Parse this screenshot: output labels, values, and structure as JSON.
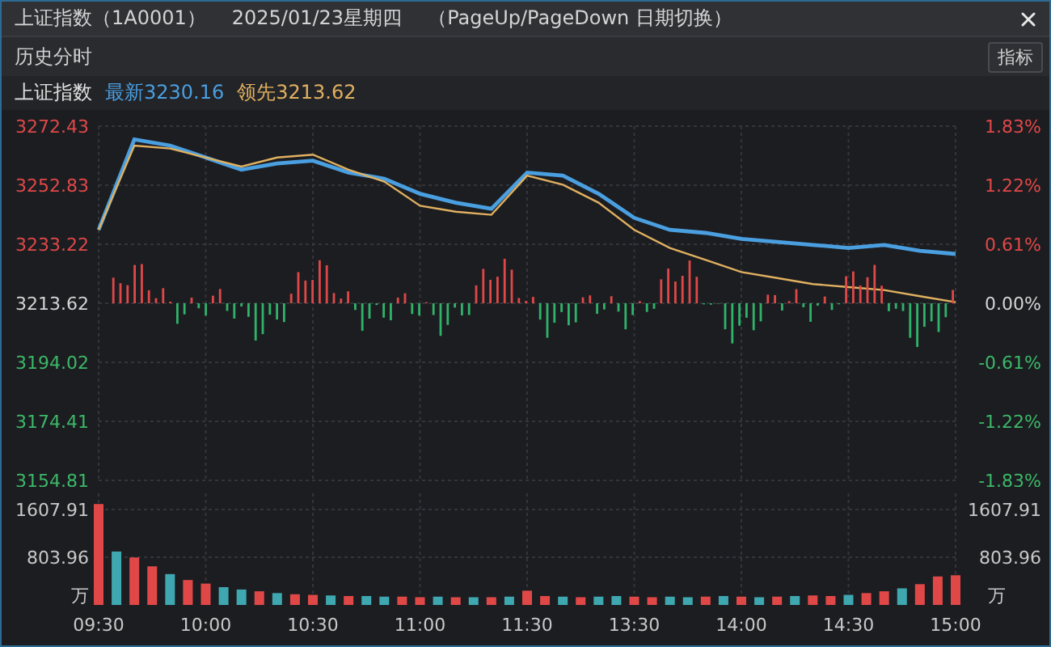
{
  "window": {
    "title_parts": [
      "上证指数（1A0001）",
      "2025/01/23星期四",
      "（PageUp/PageDown 日期切换）"
    ]
  },
  "toolbar": {
    "label": "历史分时",
    "button": "指标"
  },
  "quote": {
    "name": "上证指数",
    "latest": "最新3230.16",
    "leading": "领先3213.62"
  },
  "price_chart": {
    "chart_data": {
      "type": "line",
      "grid": true,
      "categories": [
        null,
        null,
        null,
        null,
        null,
        null,
        null,
        null,
        null,
        null,
        null,
        null,
        null,
        null,
        null,
        null,
        null,
        null,
        null,
        null,
        null,
        null,
        null,
        null,
        null
      ],
      "ylim": [
        3154.81,
        3272.43
      ],
      "yticks": [
        {
          "value": 3272.43,
          "label": "3272.43"
        },
        {
          "value": 3252.83,
          "label": "3252.83"
        },
        {
          "value": 3233.22,
          "label": "3233.22"
        },
        {
          "value": 3213.62,
          "label": "3213.62"
        },
        {
          "value": 3194.02,
          "label": "3194.02"
        },
        {
          "value": 3174.41,
          "label": "3174.41"
        },
        {
          "value": 3154.81,
          "label": "3154.81"
        }
      ],
      "series": [
        {
          "color": "#4a9fe0",
          "values": [
            3238,
            3268,
            3266,
            3262,
            3258,
            3260,
            3261,
            3257,
            3255,
            3250,
            3247,
            3245,
            3257,
            3256,
            3250,
            3242,
            3238,
            3237,
            3235,
            3234,
            3233,
            3232,
            3233,
            3231,
            3230
          ]
        },
        {
          "color": "#e0b060",
          "values": [
            3238,
            3266,
            3265,
            3262,
            3259,
            3262,
            3263,
            3258,
            3254,
            3246,
            3244,
            3243,
            3256,
            3253,
            3247,
            3238,
            3232,
            3228,
            3224,
            3222,
            3220,
            3219,
            3218,
            3216,
            3214
          ]
        }
      ]
    },
    "percent_ticks": [
      "1.83%",
      "1.22%",
      "0.61%",
      "0.00%",
      "-0.61%",
      "-1.22%",
      "-1.83%"
    ]
  },
  "volume_chart": {
    "chart_data": {
      "type": "bar",
      "grid": true,
      "ylim": [
        0,
        1880
      ],
      "yticks": [
        {
          "value": 1607.91,
          "label": "1607.91"
        },
        {
          "value": 803.96,
          "label": "803.96"
        }
      ],
      "categories": [
        "09:30",
        null,
        null,
        null,
        null,
        null,
        "10:00",
        null,
        null,
        null,
        null,
        null,
        "10:30",
        null,
        null,
        null,
        null,
        null,
        "11:00",
        null,
        null,
        null,
        null,
        null,
        "11:30",
        null,
        null,
        null,
        null,
        null,
        "13:30",
        null,
        null,
        null,
        null,
        null,
        "14:00",
        null,
        null,
        null,
        null,
        null,
        "14:30",
        null,
        null,
        null,
        null,
        null,
        "15:00"
      ],
      "series": [
        {
          "color": "#e04848",
          "values": [
            1700,
            null,
            800,
            650,
            null,
            420,
            360,
            null,
            null,
            230,
            null,
            180,
            170,
            null,
            150,
            null,
            null,
            140,
            130,
            null,
            130,
            null,
            130,
            null,
            240,
            150,
            null,
            130,
            null,
            null,
            140,
            130,
            null,
            null,
            140,
            null,
            140,
            null,
            140,
            null,
            160,
            150,
            null,
            200,
            230,
            null,
            350,
            480,
            500
          ]
        },
        {
          "color": "#3fa7b0",
          "values": [
            null,
            900,
            null,
            null,
            520,
            null,
            null,
            300,
            260,
            null,
            200,
            null,
            null,
            160,
            null,
            150,
            140,
            null,
            null,
            140,
            null,
            130,
            null,
            140,
            null,
            null,
            140,
            null,
            140,
            150,
            null,
            null,
            140,
            130,
            null,
            150,
            null,
            130,
            null,
            150,
            null,
            null,
            170,
            null,
            null,
            280,
            null,
            null,
            null
          ]
        }
      ]
    },
    "unit": "万",
    "right_ticks": [
      "1607.91",
      "803.96"
    ],
    "right_unit": "万"
  }
}
